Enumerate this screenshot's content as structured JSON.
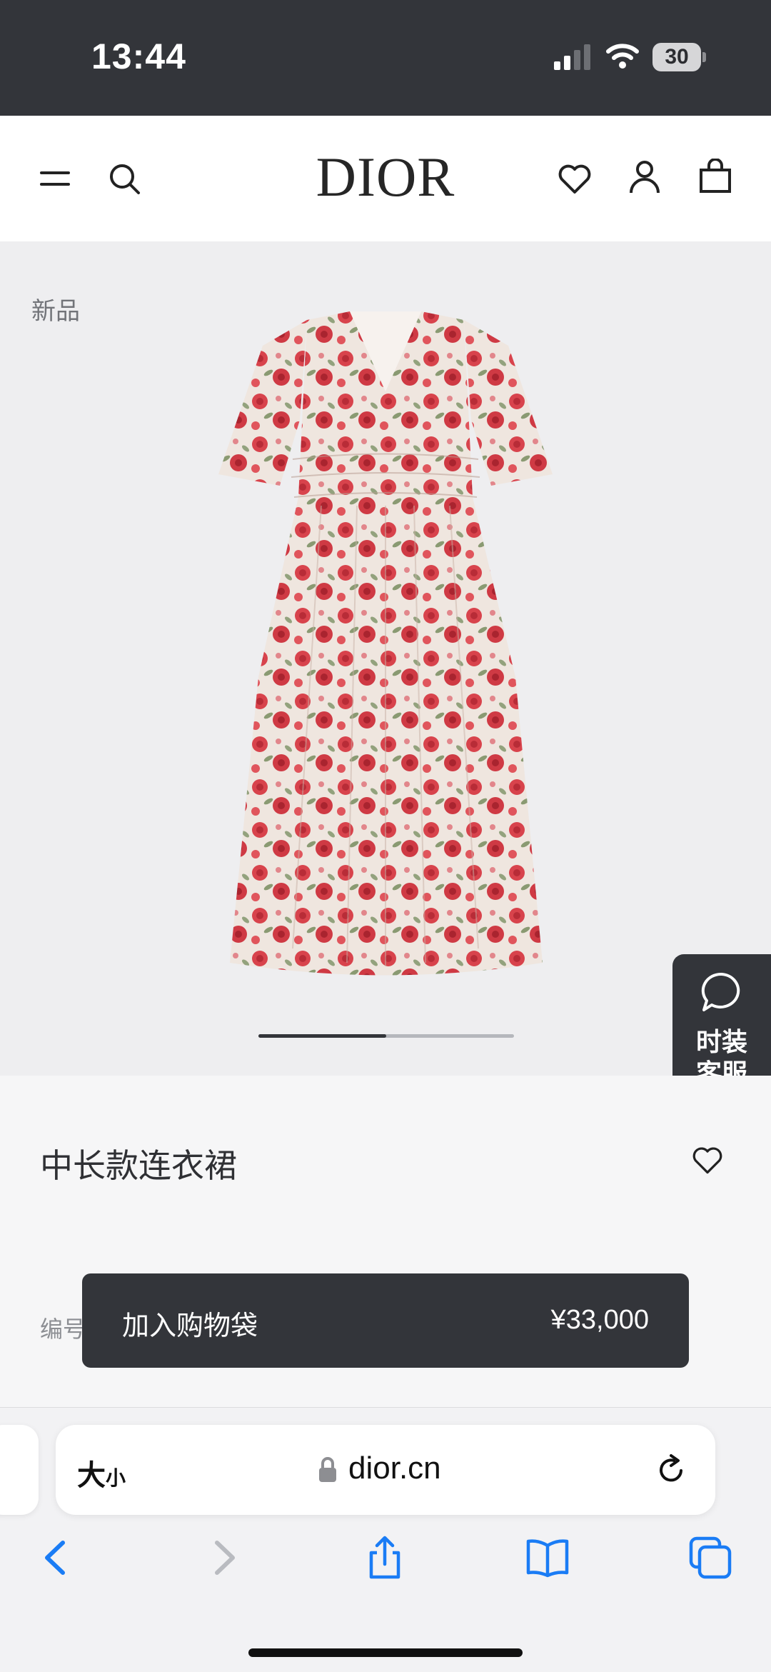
{
  "status_bar": {
    "time": "13:44",
    "battery": "30"
  },
  "header": {
    "logo": "DIOR",
    "icons": [
      "menu-icon",
      "search-icon",
      "heart-icon",
      "account-icon",
      "shopping-bag-icon"
    ]
  },
  "product": {
    "badge": "新品",
    "title": "中长款连衣裙",
    "reference_label": "编号",
    "image_carousel_progress": 0.5
  },
  "service": {
    "label_line1": "时装",
    "label_line2": "客服"
  },
  "add_to_bag": {
    "label": "加入购物袋",
    "price": "¥33,000"
  },
  "browser": {
    "text_size_big": "大",
    "text_size_small": "小",
    "url": "dior.cn",
    "toolbar_icons": [
      "back-icon",
      "forward-icon",
      "share-icon",
      "bookmarks-icon",
      "tabs-icon"
    ]
  },
  "colors": {
    "dark": "#33353a",
    "ios_blue": "#1a7cf5",
    "media_bg": "#eeeef0"
  }
}
